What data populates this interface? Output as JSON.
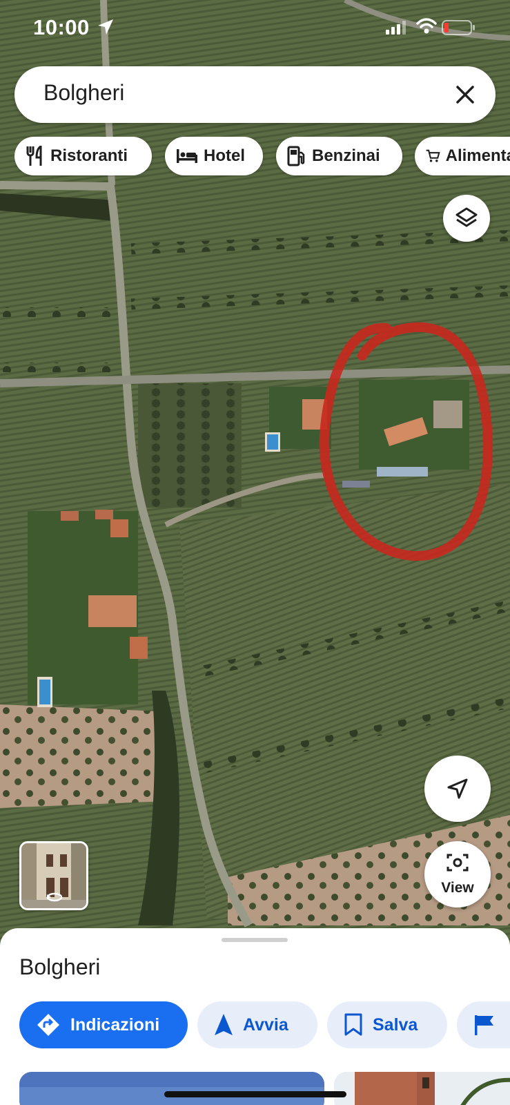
{
  "status_bar": {
    "time": "10:00",
    "location_icon": "location-arrow-icon",
    "signal_icon": "cellular-signal-icon",
    "wifi_icon": "wifi-icon",
    "battery_icon": "battery-low-icon",
    "battery_color": "#ff3b30"
  },
  "search": {
    "query": "Bolgheri",
    "clear_icon": "close-icon"
  },
  "chips": [
    {
      "label": "Ristoranti",
      "icon": "restaurant-icon"
    },
    {
      "label": "Hotel",
      "icon": "hotel-bed-icon"
    },
    {
      "label": "Benzinai",
      "icon": "gas-station-icon"
    },
    {
      "label": "Alimentari",
      "icon": "shopping-cart-icon"
    }
  ],
  "map": {
    "mode": "satellite",
    "layers_icon": "layers-icon",
    "highlight_color": "#c8281e"
  },
  "floating_buttons": {
    "navigate_icon": "navigation-arrow-icon",
    "view_label": "View",
    "view_icon": "camera-lens-icon",
    "street_view_icon": "street-view-rotate-icon"
  },
  "place_sheet": {
    "title": "Bolgheri",
    "actions": [
      {
        "label": "Indicazioni",
        "icon": "directions-icon",
        "primary": true
      },
      {
        "label": "Avvia",
        "icon": "navigation-start-icon",
        "primary": false
      },
      {
        "label": "Salva",
        "icon": "bookmark-icon",
        "primary": false
      },
      {
        "label": "",
        "icon": "flag-icon",
        "primary": false
      }
    ]
  },
  "colors": {
    "accent": "#1a6ef0",
    "accent_text": "#0b57d0",
    "secondary_button": "#e8eef9"
  }
}
